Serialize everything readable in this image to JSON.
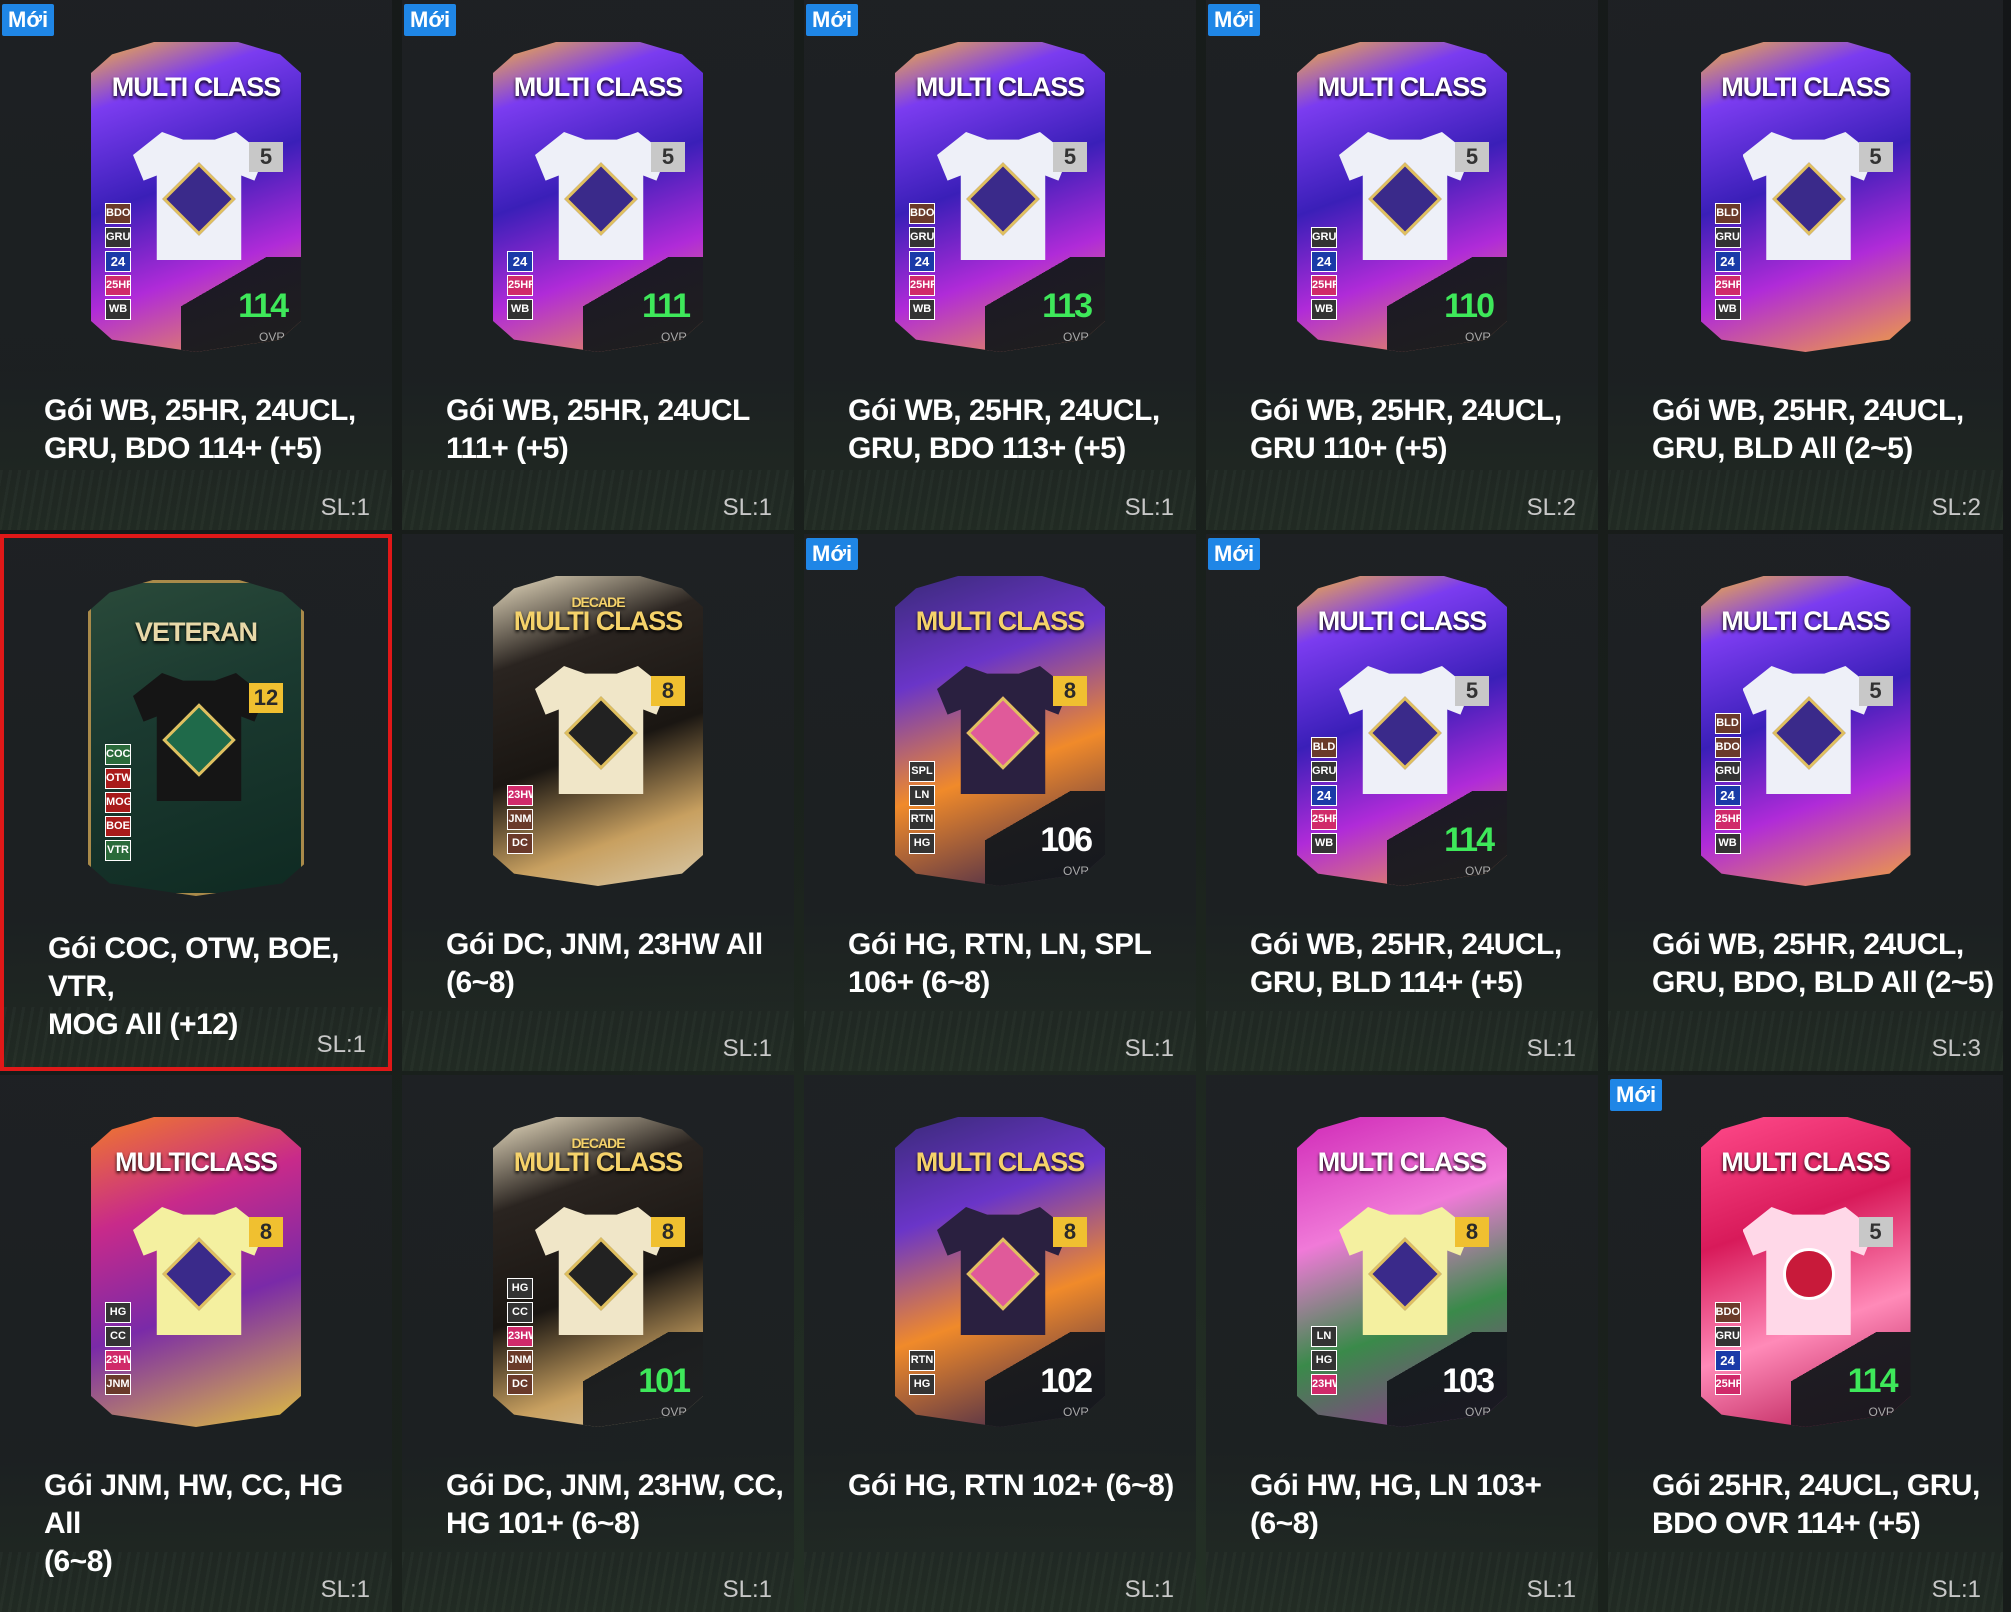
{
  "labels": {
    "new": "Mới",
    "ovr": "OVR"
  },
  "packs": [
    {
      "new": true,
      "style": "purple",
      "title": "MULTI CLASS",
      "subtitle": "",
      "level": "5",
      "chips": [
        "BDO",
        "GRU",
        "24",
        "25HR",
        "WB"
      ],
      "ovr": "114",
      "name": "Gói WB, 25HR, 24UCL,\nGRU, BDO 114+ (+5)",
      "qty": "SL:1"
    },
    {
      "new": true,
      "style": "purple",
      "title": "MULTI CLASS",
      "subtitle": "",
      "level": "5",
      "chips": [
        "24",
        "25HR",
        "WB"
      ],
      "ovr": "111",
      "name": "Gói WB, 25HR, 24UCL\n111+ (+5)",
      "qty": "SL:1"
    },
    {
      "new": true,
      "style": "purple",
      "title": "MULTI CLASS",
      "subtitle": "",
      "level": "5",
      "chips": [
        "BDO",
        "GRU",
        "24",
        "25HR",
        "WB"
      ],
      "ovr": "113",
      "name": "Gói WB, 25HR, 24UCL,\nGRU, BDO 113+ (+5)",
      "qty": "SL:1"
    },
    {
      "new": true,
      "style": "purple",
      "title": "MULTI CLASS",
      "subtitle": "",
      "level": "5",
      "chips": [
        "GRU",
        "24",
        "25HR",
        "WB"
      ],
      "ovr": "110",
      "name": "Gói WB, 25HR, 24UCL,\nGRU 110+ (+5)",
      "qty": "SL:2"
    },
    {
      "new": false,
      "style": "purple",
      "title": "MULTI CLASS",
      "subtitle": "",
      "level": "5",
      "chips": [
        "BLD",
        "GRU",
        "24",
        "25HR",
        "WB"
      ],
      "ovr": "",
      "name": "Gói WB, 25HR, 24UCL,\nGRU, BLD All (2~5)",
      "qty": "SL:2"
    },
    {
      "new": false,
      "style": "veteran",
      "title": "VETERAN",
      "subtitle": "",
      "level": "12",
      "chips": [
        "COC",
        "OTW",
        "MOG",
        "BOE",
        "VTR"
      ],
      "ovr": "",
      "name": "Gói COC, OTW, BOE, VTR,\nMOG All (+12)",
      "qty": "SL:1",
      "selected": true
    },
    {
      "new": false,
      "style": "decade",
      "title": "MULTI CLASS",
      "subtitle": "DECADE",
      "level": "8",
      "chips": [
        "23HW",
        "JNM",
        "DC"
      ],
      "ovr": "",
      "name": "Gói DC, JNM, 23HW All\n(6~8)",
      "qty": "SL:1"
    },
    {
      "new": true,
      "style": "hg",
      "title": "MULTI CLASS",
      "subtitle": "",
      "level": "8",
      "chips": [
        "SPL",
        "LN",
        "RTN",
        "HG"
      ],
      "ovr": "106",
      "name": "Gói HG, RTN, LN, SPL\n106+ (6~8)",
      "qty": "SL:1"
    },
    {
      "new": true,
      "style": "purple",
      "title": "MULTI CLASS",
      "subtitle": "",
      "level": "5",
      "chips": [
        "BLD",
        "GRU",
        "24",
        "25HR",
        "WB"
      ],
      "ovr": "114",
      "name": "Gói WB, 25HR, 24UCL,\nGRU, BLD 114+ (+5)",
      "qty": "SL:1"
    },
    {
      "new": false,
      "style": "purple",
      "title": "MULTI CLASS",
      "subtitle": "",
      "level": "5",
      "chips": [
        "BLD",
        "BDO",
        "GRU",
        "24",
        "25HR",
        "WB"
      ],
      "ovr": "",
      "name": "Gói WB, 25HR, 24UCL,\nGRU, BDO, BLD All (2~5)",
      "qty": "SL:3"
    },
    {
      "new": false,
      "style": "jnm",
      "title": "MULTICLASS",
      "subtitle": "",
      "level": "8",
      "chips": [
        "HG",
        "CC",
        "23HW",
        "JNM"
      ],
      "ovr": "",
      "name": "Gói JNM, HW, CC, HG All\n(6~8)",
      "qty": "SL:1"
    },
    {
      "new": false,
      "style": "decade",
      "title": "MULTI CLASS",
      "subtitle": "DECADE",
      "level": "8",
      "chips": [
        "HG",
        "CC",
        "23HW",
        "JNM",
        "DC"
      ],
      "ovr": "101",
      "name": "Gói DC, JNM, 23HW, CC,\nHG 101+ (6~8)",
      "qty": "SL:1"
    },
    {
      "new": false,
      "style": "hg",
      "title": "MULTI CLASS",
      "subtitle": "",
      "level": "8",
      "chips": [
        "RTN",
        "HG"
      ],
      "ovr": "102",
      "name": "Gói HG, RTN 102+ (6~8)",
      "qty": "SL:1"
    },
    {
      "new": false,
      "style": "hw",
      "title": "MULTI CLASS",
      "subtitle": "",
      "level": "8",
      "chips": [
        "LN",
        "HG",
        "23HW"
      ],
      "ovr": "103",
      "name": "Gói HW, HG, LN 103+\n(6~8)",
      "qty": "SL:1"
    },
    {
      "new": true,
      "style": "pink",
      "title": "MULTI CLASS",
      "subtitle": "",
      "level": "5",
      "chips": [
        "BDO",
        "GRU",
        "24",
        "25HR"
      ],
      "ovr": "114",
      "name": "Gói 25HR, 24UCL, GRU,\nBDO OVR 114+ (+5)",
      "qty": "SL:1"
    }
  ],
  "colors": {
    "new_badge": "#1f86e6",
    "ovr_up": "#3ee85a",
    "selected_border": "#e01818"
  }
}
